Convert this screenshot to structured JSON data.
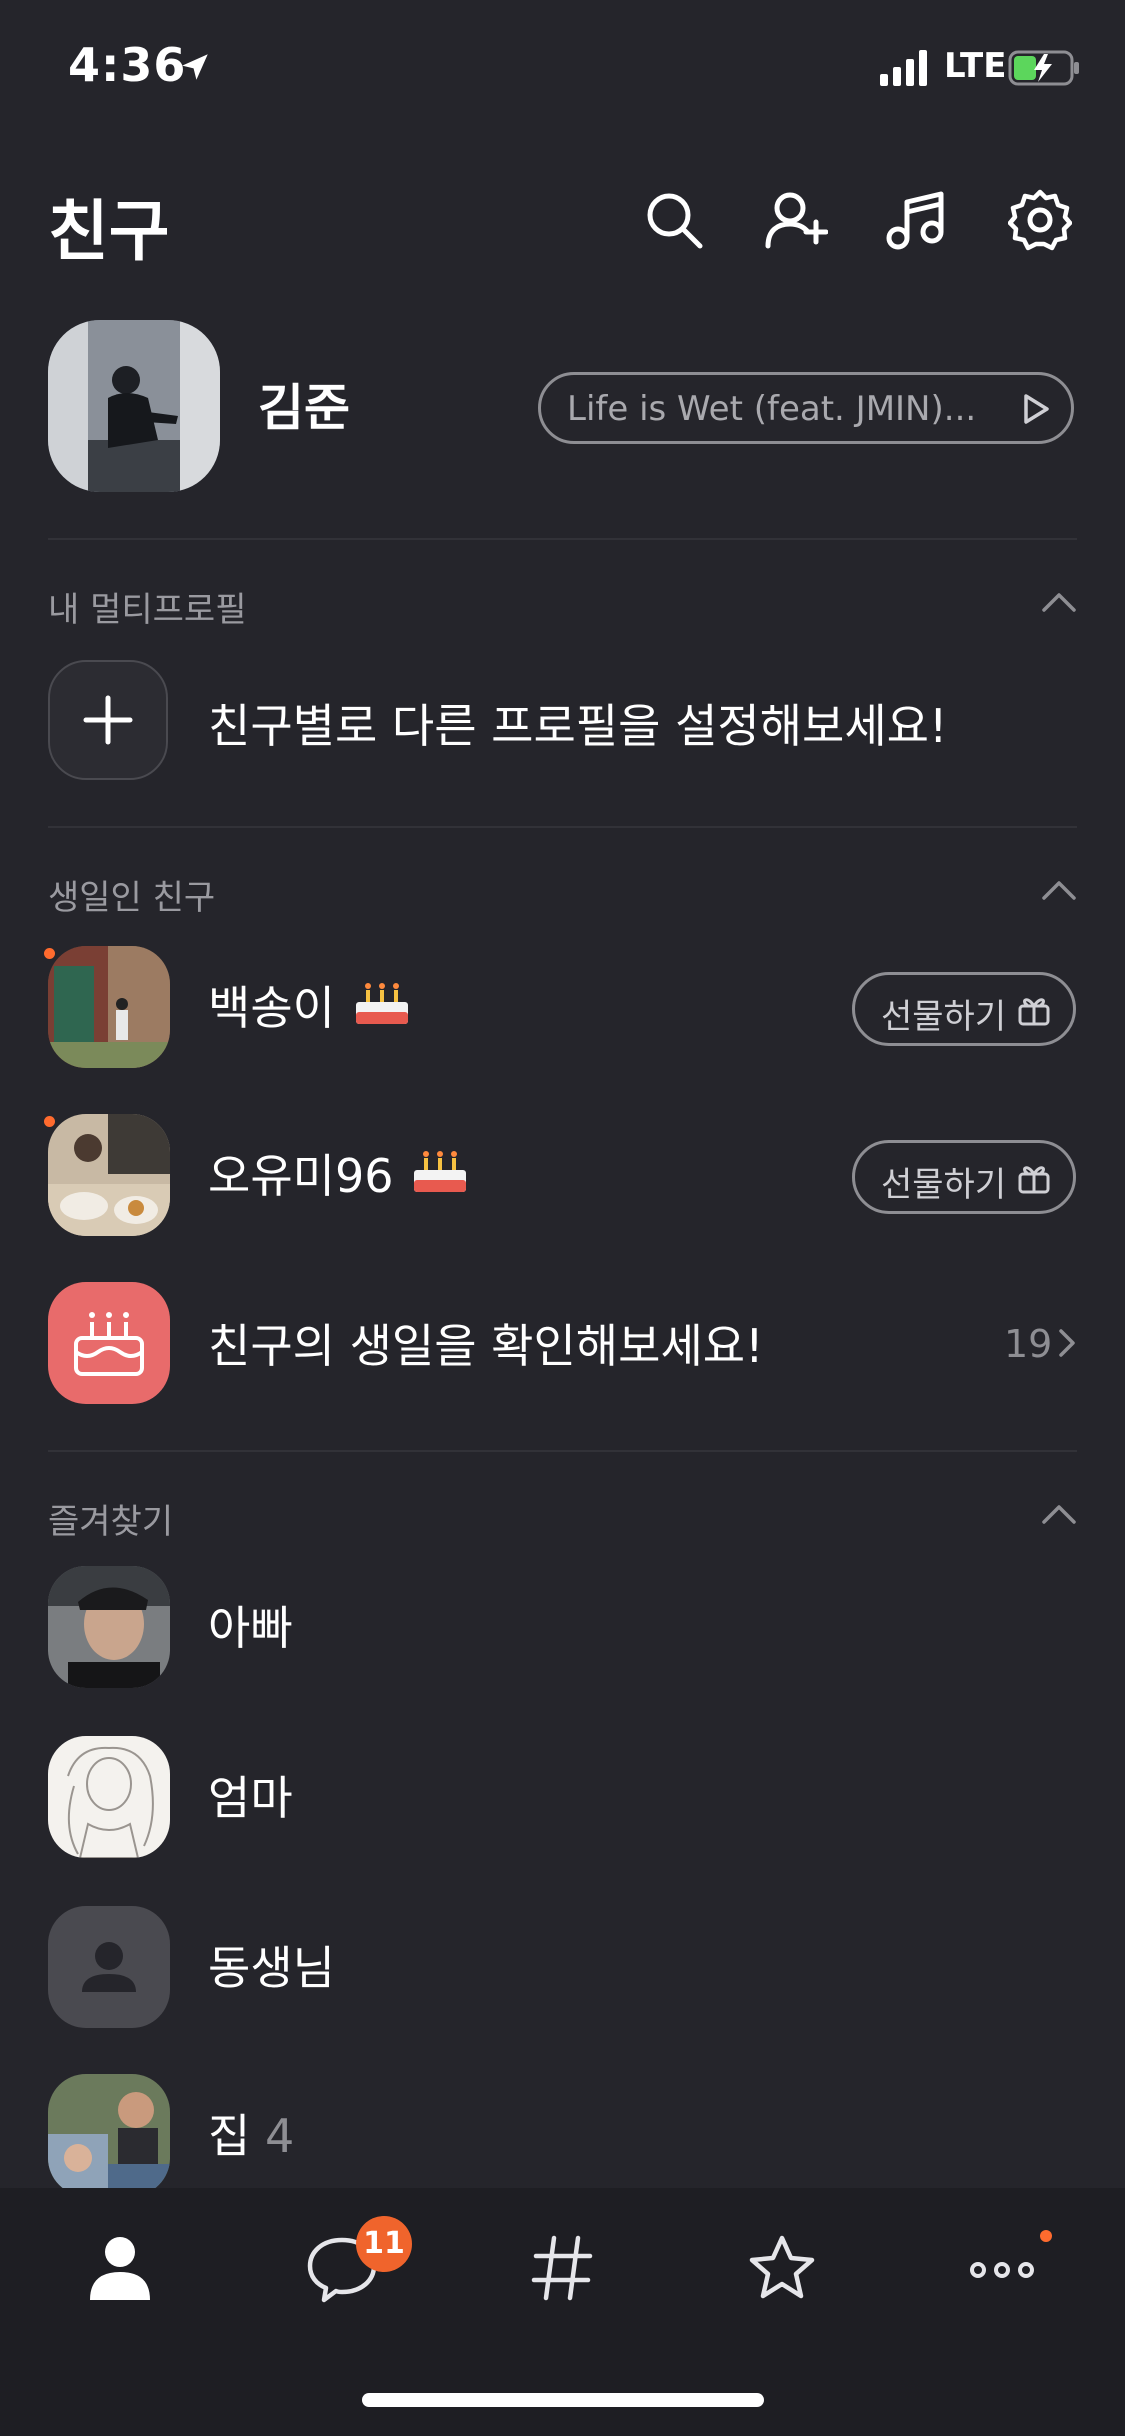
{
  "status_bar": {
    "time": "4:36",
    "network": "LTE"
  },
  "header": {
    "title": "친구"
  },
  "profile": {
    "name": "김준",
    "music": "Life is Wet (feat. JMIN)..."
  },
  "multi_profile": {
    "section_title": "내 멀티프로필",
    "prompt": "친구별로 다른 프로필을 설정해보세요!"
  },
  "birthday": {
    "section_title": "생일인 친구",
    "friends": [
      {
        "name": "백송이",
        "gift_label": "선물하기"
      },
      {
        "name": "오유미96",
        "gift_label": "선물하기"
      }
    ],
    "check_prompt": "친구의 생일을 확인해보세요!",
    "check_count": "19"
  },
  "favorites": {
    "section_title": "즐겨찾기",
    "items": [
      {
        "name": "아빠"
      },
      {
        "name": "엄마"
      },
      {
        "name": "동생님"
      },
      {
        "name": "집",
        "count": "4"
      }
    ]
  },
  "tabbar": {
    "chat_badge": "11",
    "items": [
      "friends-icon",
      "chat-icon",
      "hashtag-icon",
      "star-icon",
      "more-icon"
    ]
  },
  "colors": {
    "background": "#25252b",
    "accent": "#ff6b2e",
    "birthday": "#e86b6b"
  }
}
